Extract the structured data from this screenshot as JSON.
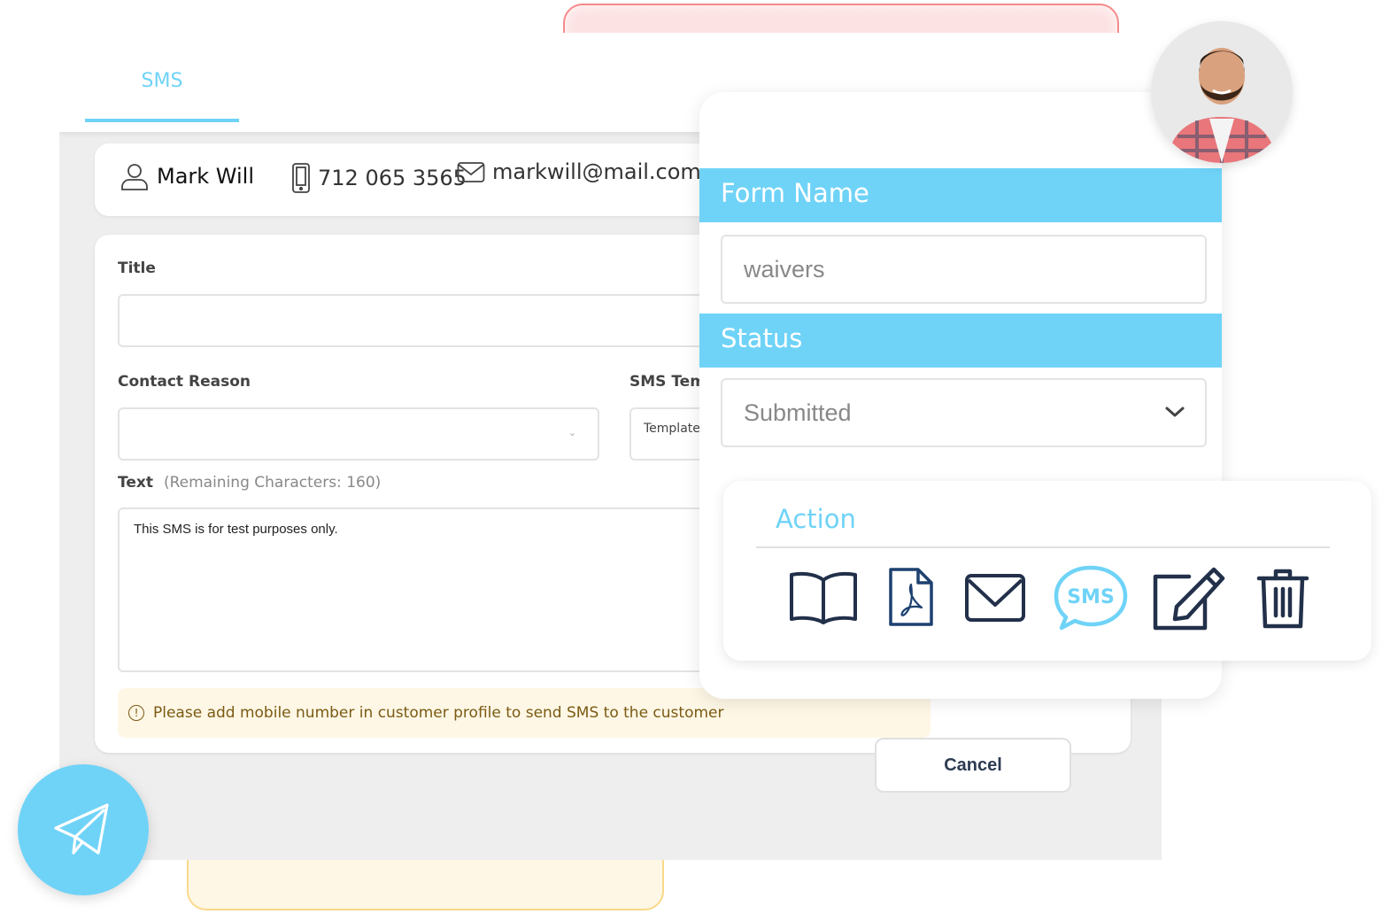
{
  "tabs": [
    {
      "label": "SMS",
      "active": true
    }
  ],
  "contact": {
    "name": "Mark Will",
    "phone": "712 065 3565",
    "email": "markwill@mail.com"
  },
  "form": {
    "title_label": "Title",
    "title_value": "",
    "contact_reason_label": "Contact Reason",
    "contact_reason_value": "",
    "sms_template_label": "SMS Tem",
    "sms_template_value": "Template",
    "text_label": "Text",
    "remaining_chars": "(Remaining Characters: 160)",
    "text_value": "This SMS is for test purposes only.",
    "warning": "Please add mobile number in customer profile to send SMS to the customer"
  },
  "cancel_label": "Cancel",
  "overlay": {
    "form_name_label": "Form Name",
    "form_name_value": "waivers",
    "status_label": "Status",
    "status_value": "Submitted"
  },
  "action": {
    "title": "Action",
    "icons": [
      "book-icon",
      "pdf-icon",
      "email-icon",
      "sms-icon",
      "edit-icon",
      "trash-icon"
    ],
    "sms_glyph": "SMS"
  },
  "colors": {
    "accent": "#6fd3f7",
    "icon_dark": "#22304a",
    "warning_bg": "#fef7e6",
    "warning_text": "#7b5a12"
  }
}
